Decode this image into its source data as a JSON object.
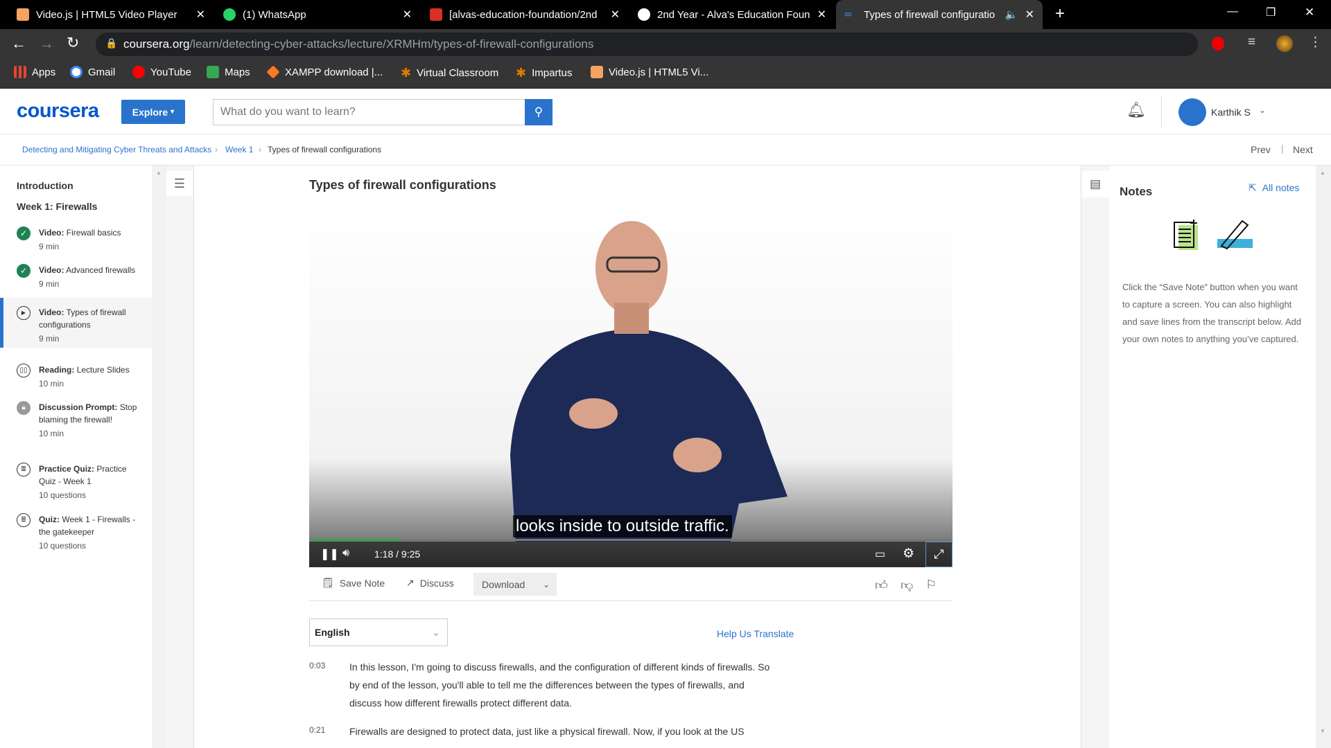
{
  "browser": {
    "tabs": [
      {
        "title": "Video.js | HTML5 Video Player",
        "favicon": "#f4a460"
      },
      {
        "title": "(1) WhatsApp",
        "favicon": "#25d366"
      },
      {
        "title": "[alvas-education-foundation/2nd",
        "favicon": "#d93025"
      },
      {
        "title": "2nd Year - Alva's Education Found",
        "favicon": "#ffffff"
      },
      {
        "title": "Types of firewall configuratio",
        "favicon": "#0056d2",
        "active": true
      }
    ],
    "url_host": "coursera.org",
    "url_path": "/learn/detecting-cyber-attacks/lecture/XRMHm/types-of-firewall-configurations",
    "bookmarks": [
      {
        "label": "Apps",
        "color": "#ea4335"
      },
      {
        "label": "Gmail",
        "color": "#4285f4"
      },
      {
        "label": "YouTube",
        "color": "#ff0000"
      },
      {
        "label": "Maps",
        "color": "#34a853"
      },
      {
        "label": "XAMPP download |...",
        "color": "#fb7a24"
      },
      {
        "label": "Virtual Classroom",
        "color": "#e07b00"
      },
      {
        "label": "Impartus",
        "color": "#e07b00"
      },
      {
        "label": "Video.js | HTML5 Vi...",
        "color": "#f4a460"
      }
    ]
  },
  "header": {
    "logo": "coursera",
    "explore": "Explore",
    "search_placeholder": "What do you want to learn?",
    "user": "Karthik S"
  },
  "breadcrumb": {
    "course": "Detecting and Mitigating Cyber Threats and Attacks",
    "week": "Week 1",
    "current": "Types of firewall configurations",
    "prev": "Prev",
    "next": "Next"
  },
  "sidebar": {
    "intro": "Introduction",
    "week": "Week 1: Firewalls",
    "items": [
      {
        "type": "Video:",
        "title": "Firewall basics",
        "dur": "9 min",
        "status": "done"
      },
      {
        "type": "Video:",
        "title": "Advanced firewalls",
        "dur": "9 min",
        "status": "done"
      },
      {
        "type": "Video:",
        "title": "Types of firewall configurations",
        "dur": "9 min",
        "status": "current"
      },
      {
        "type": "Reading:",
        "title": "Lecture Slides",
        "dur": "10 min",
        "status": "reading"
      },
      {
        "type": "Discussion Prompt:",
        "title": "Stop blaming the firewall!",
        "dur": "10 min",
        "status": "locked"
      },
      {
        "type": "Practice Quiz:",
        "title": "Practice Quiz - Week 1",
        "dur": "10 questions",
        "status": "quiz"
      },
      {
        "type": "Quiz:",
        "title": "Week 1 - Firewalls - the gatekeeper",
        "dur": "10 questions",
        "status": "quiz"
      }
    ]
  },
  "lecture": {
    "title": "Types of firewall configurations",
    "subtitle": "looks inside to outside traffic.",
    "current_time": "1:18",
    "duration": "9:25",
    "progress": 0.138,
    "save_note": "Save Note",
    "discuss": "Discuss",
    "download": "Download",
    "language": "English",
    "help_translate": "Help Us Translate",
    "transcript": [
      {
        "time": "0:03",
        "lines": [
          "In this lesson, I'm going to discuss firewalls, and the configuration of different kinds of firewalls. So",
          "by end of the lesson, you'll able to tell me the differences between the types of firewalls, and",
          "discuss how different firewalls protect different data."
        ]
      },
      {
        "time": "0:21",
        "lines": [
          "Firewalls are designed to protect data, just like a physical firewall. Now, if you look at the US"
        ]
      }
    ]
  },
  "notes": {
    "title": "Notes",
    "all_notes": "All notes",
    "help": "Click the “Save Note” button when you want to capture a screen. You can also highlight and save lines from the transcript below. Add your own notes to anything you’ve captured."
  },
  "colors": {
    "brand": "#0056d2",
    "done": "#1f8354",
    "link": "#2a73cc"
  }
}
